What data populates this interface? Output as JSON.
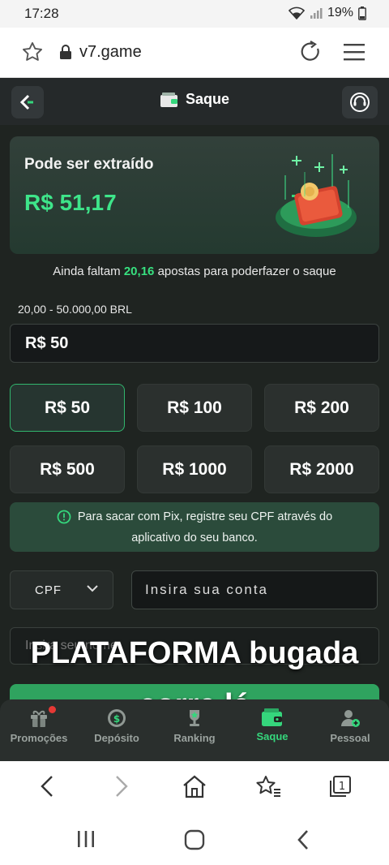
{
  "status_bar": {
    "time": "17:28",
    "battery": "19%"
  },
  "browser": {
    "url": "v7.game"
  },
  "header": {
    "title": "Saque"
  },
  "balance": {
    "label": "Pode ser extraído",
    "amount": "R$ 51,17"
  },
  "requirement": {
    "prefix": "Ainda faltam",
    "count": "20,16",
    "suffix": "apostas para poderfazer o saque"
  },
  "limits": "20,00 - 50.000,00 BRL",
  "amount_input": {
    "value": "R$ 50"
  },
  "presets": [
    "R$ 50",
    "R$ 100",
    "R$ 200",
    "R$ 500",
    "R$ 1000",
    "R$ 2000"
  ],
  "pix_note": {
    "line1": "Para sacar com Pix, registre seu CPF através do",
    "line2": "aplicativo do seu banco."
  },
  "account": {
    "type": "CPF",
    "placeholder": "Insira sua conta"
  },
  "name_input": {
    "placeholder": "Insira seu nome"
  },
  "overlay": {
    "line1": "PLATAFORMA bugada",
    "line2": "corre lá"
  },
  "nav": [
    {
      "label": "Promoções",
      "icon": "gift-icon"
    },
    {
      "label": "Depósito",
      "icon": "coin-icon"
    },
    {
      "label": "Ranking",
      "icon": "trophy-icon"
    },
    {
      "label": "Saque",
      "icon": "wallet-icon"
    },
    {
      "label": "Pessoal",
      "icon": "person-icon"
    }
  ],
  "colors": {
    "accent": "#35d67c",
    "background": "#1f2421",
    "card": "#2b302e"
  }
}
